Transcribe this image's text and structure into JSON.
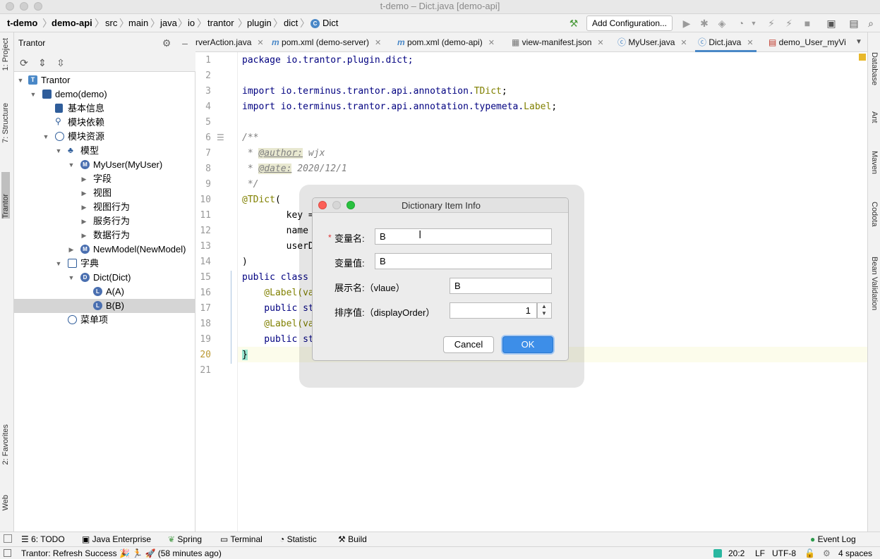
{
  "window": {
    "title": "t-demo – Dict.java [demo-api]"
  },
  "breadcrumb": [
    "t-demo",
    "demo-api",
    "src",
    "main",
    "java",
    "io",
    "trantor",
    "plugin",
    "dict",
    "Dict"
  ],
  "toolbar": {
    "add_configuration": "Add Configuration..."
  },
  "left_strip": {
    "project": "1: Project",
    "structure": "7: Structure",
    "tantor": "Trantor",
    "favorites": "2: Favorites",
    "web": "Web"
  },
  "right_strip": {
    "database": "Database",
    "ant": "Ant",
    "maven": "Maven",
    "codota": "Codota",
    "bean_validation": "Bean Validation"
  },
  "panel": {
    "title": "Trantor"
  },
  "tree": [
    {
      "label": "Trantor"
    },
    {
      "label": "demo(demo)"
    },
    {
      "label": "基本信息"
    },
    {
      "label": "模块依赖"
    },
    {
      "label": "模块资源"
    },
    {
      "label": "模型"
    },
    {
      "label": "MyUser(MyUser)"
    },
    {
      "label": "字段"
    },
    {
      "label": "视图"
    },
    {
      "label": "视图行为"
    },
    {
      "label": "服务行为"
    },
    {
      "label": "数据行为"
    },
    {
      "label": "NewModel(NewModel)"
    },
    {
      "label": "字典"
    },
    {
      "label": "Dict(Dict)"
    },
    {
      "label": "A(A)"
    },
    {
      "label": "B(B)"
    },
    {
      "label": "菜单项"
    }
  ],
  "tabs": [
    "rverAction.java",
    "pom.xml (demo-server)",
    "pom.xml (demo-api)",
    "view-manifest.json",
    "MyUser.java",
    "Dict.java",
    "demo_User_myVi"
  ],
  "code": {
    "line_numbers": [
      "1",
      "2",
      "3",
      "4",
      "5",
      "6",
      "7",
      "8",
      "9",
      "10",
      "11",
      "12",
      "13",
      "14",
      "15",
      "16",
      "17",
      "18",
      "19",
      "20",
      "21"
    ],
    "l1": "package io.trantor.plugin.dict;",
    "l3a": "import io.terminus.trantor.api.annotation.",
    "l3b": "TDict",
    "l3c": ";",
    "l4a": "import io.terminus.trantor.api.annotation.typemeta.",
    "l4b": "Label",
    "l4c": ";",
    "l6": "/**",
    "l7a": " * ",
    "l7b": "@author:",
    "l7c": " wjx",
    "l8a": " * ",
    "l8b": "@date:",
    "l8c": " 2020/12/1",
    "l9": " */",
    "l10a": "@TDict",
    "l10b": "(",
    "l11": "        key =",
    "l12": "        name",
    "l13": "        userD",
    "l14": ")",
    "l15a": "public class",
    "l16": "    @Label(va",
    "l17": "    public st",
    "l18": "    @Label(va",
    "l19": "    public st",
    "l20": "}"
  },
  "dialog": {
    "title": "Dictionary Item Info",
    "required_mark": "*",
    "var_name_label": "变量名:",
    "var_name_value": "B",
    "var_value_label": "变量值:",
    "var_value_value": "B",
    "display_name_label": "展示名:（vlaue）",
    "display_name_value": "B",
    "order_label": "排序值:（displayOrder）",
    "order_value": "1",
    "cancel": "Cancel",
    "ok": "OK"
  },
  "bottom_tools": [
    "6: TODO",
    "Java Enterprise",
    "Spring",
    "Terminal",
    "Statistic",
    "Build",
    "Event Log"
  ],
  "status": {
    "message": "Trantor: Refresh Success 🎉 🏃 🚀 (58 minutes ago)",
    "position": "20:2",
    "line_sep": "LF",
    "encoding": "UTF-8",
    "indent": "4 spaces"
  },
  "colors": {
    "accent": "#4a88c7",
    "ok_button": "#3d8ee8",
    "close": "#fc5f57",
    "maximize": "#29c13f"
  }
}
